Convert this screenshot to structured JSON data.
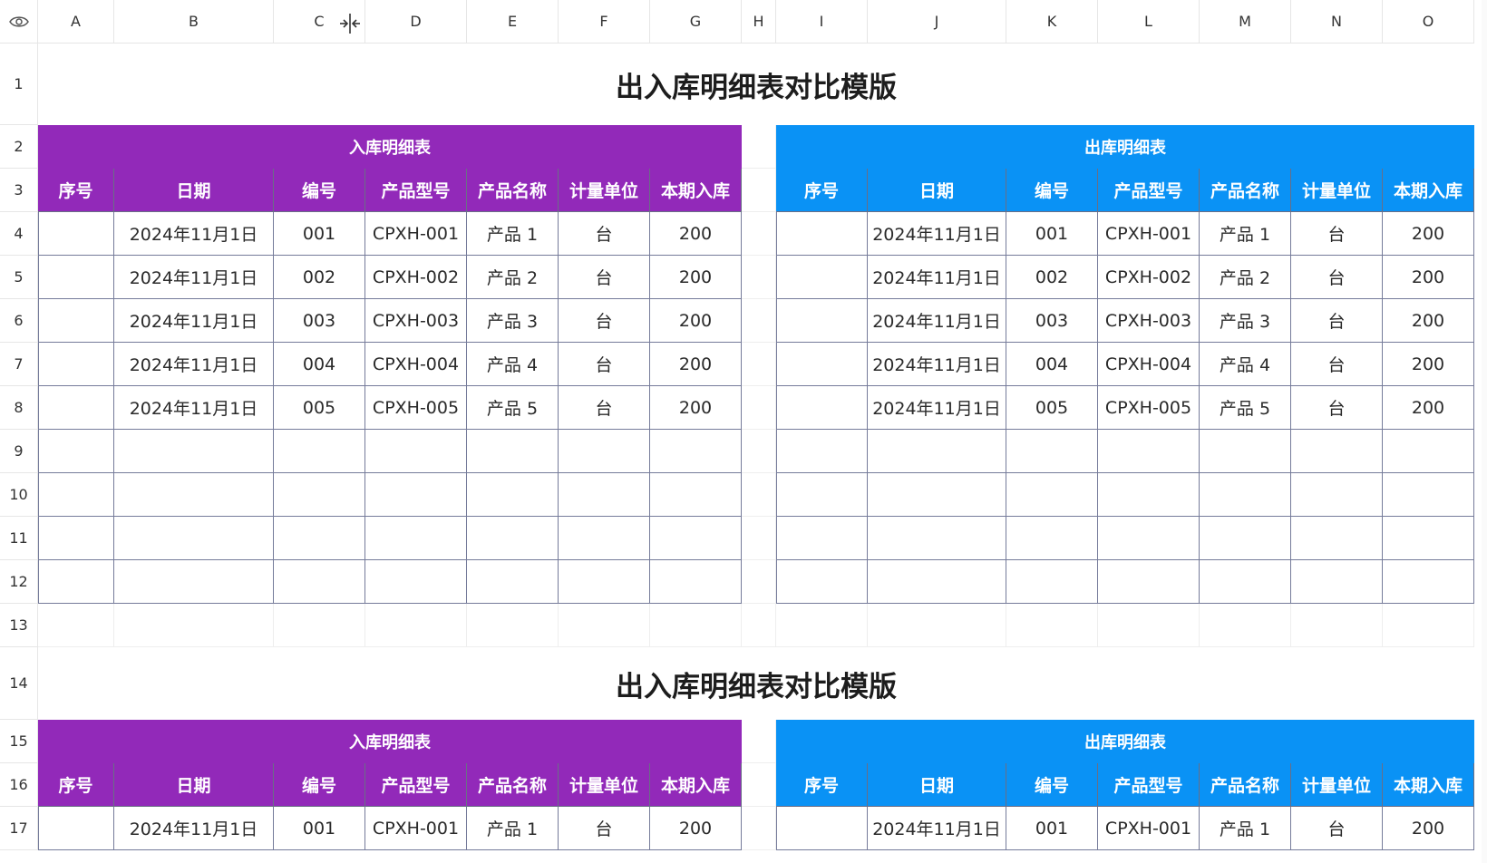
{
  "columns": [
    "A",
    "B",
    "C",
    "D",
    "E",
    "F",
    "G",
    "H",
    "I",
    "J",
    "K",
    "L",
    "M",
    "N",
    "O"
  ],
  "rows": [
    "1",
    "2",
    "3",
    "4",
    "5",
    "6",
    "7",
    "8",
    "9",
    "10",
    "11",
    "12",
    "13",
    "14",
    "15",
    "16",
    "17"
  ],
  "title": "出入库明细表对比模版",
  "in_table": {
    "title": "入库明细表",
    "color": "#9229b9",
    "headers": [
      "序号",
      "日期",
      "编号",
      "产品型号",
      "产品名称",
      "计量单位",
      "本期入库"
    ]
  },
  "out_table": {
    "title": "出库明细表",
    "color": "#0a92f5",
    "headers": [
      "序号",
      "日期",
      "编号",
      "产品型号",
      "产品名称",
      "计量单位",
      "本期入库"
    ]
  },
  "records": [
    {
      "seq": "",
      "date": "2024年11月1日",
      "code": "001",
      "model": "CPXH-001",
      "name": "产品 1",
      "unit": "台",
      "qty": "200"
    },
    {
      "seq": "",
      "date": "2024年11月1日",
      "code": "002",
      "model": "CPXH-002",
      "name": "产品 2",
      "unit": "台",
      "qty": "200"
    },
    {
      "seq": "",
      "date": "2024年11月1日",
      "code": "003",
      "model": "CPXH-003",
      "name": "产品 3",
      "unit": "台",
      "qty": "200"
    },
    {
      "seq": "",
      "date": "2024年11月1日",
      "code": "004",
      "model": "CPXH-004",
      "name": "产品 4",
      "unit": "台",
      "qty": "200"
    },
    {
      "seq": "",
      "date": "2024年11月1日",
      "code": "005",
      "model": "CPXH-005",
      "name": "产品 5",
      "unit": "台",
      "qty": "200"
    }
  ],
  "second_block_records": [
    {
      "seq": "",
      "date": "2024年11月1日",
      "code": "001",
      "model": "CPXH-001",
      "name": "产品 1",
      "unit": "台",
      "qty": "200"
    }
  ],
  "icons": {
    "corner": "eye-icon",
    "cursor": "column-resize-cursor-icon"
  },
  "colors": {
    "grid_line": "#757b9a",
    "header_border": "#e6e6e6"
  }
}
